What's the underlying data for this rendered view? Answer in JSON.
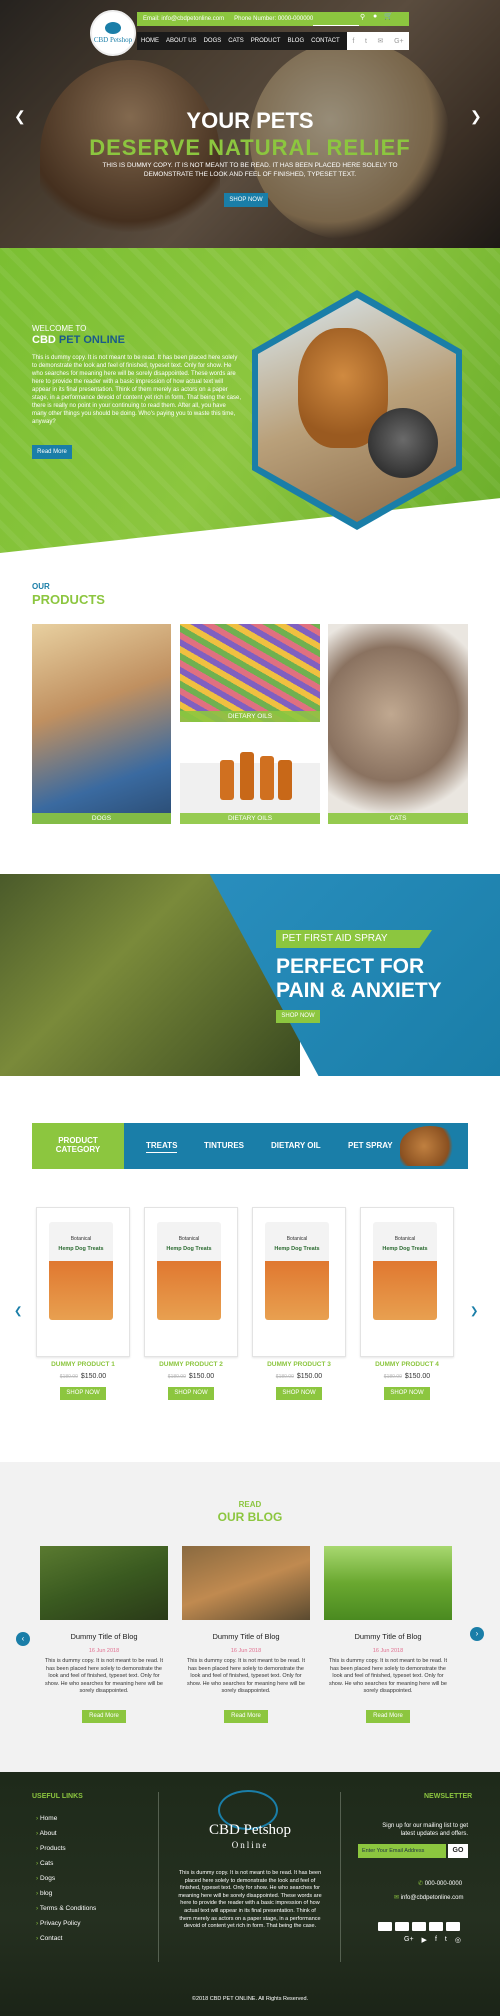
{
  "header": {
    "logo_text": "CBD Petshop",
    "topbar_email": "Email: info@cbdpetonline.com",
    "topbar_phone": "Phone Number: 0000-000000",
    "cart_count": "0",
    "nav": [
      "HOME",
      "ABOUT US",
      "DOGS",
      "CATS",
      "PRODUCT",
      "BLOG",
      "CONTACT"
    ],
    "social_icons": [
      "f",
      "t",
      "✉",
      "G+"
    ]
  },
  "hero": {
    "title1": "YOUR PETS",
    "title2": "DESERVE NATURAL RELIEF",
    "subtitle": "THIS IS DUMMY COPY. IT IS NOT MEANT TO BE READ. IT HAS BEEN PLACED HERE SOLELY TO DEMONSTRATE THE LOOK AND FEEL OF FINISHED, TYPESET TEXT.",
    "button": "SHOP NOW"
  },
  "welcome": {
    "small": "WELCOME TO",
    "title_a": "CBD",
    "title_b": "PET ONLINE",
    "text": "This is dummy copy. It is not meant to be read. It has been placed here solely to demonstrate the look and feel of finished, typeset text. Only for show. He who searches for meaning here will be sorely disappointed. These words are here to provide the reader with a basic impression of how actual text will appear in its final presentation. Think of them merely as actors on a paper stage, in a performance devoid of content yet rich in form. That being the case, there is really no point in your continuing to read them. After all, you have many other things you should be doing. Who's paying you to waste this time, anyway?",
    "button": "Read More"
  },
  "products": {
    "small": "OUR",
    "title": "PRODUCTS",
    "tiles": [
      "DOGS",
      "DIETARY OILS",
      "DIETARY OILS",
      "CATS"
    ]
  },
  "promo": {
    "tag": "PET FIRST AID SPRAY",
    "line1": "PERFECT FOR",
    "line2": "PAIN & ANXIETY",
    "button": "SHOP NOW"
  },
  "category": {
    "label_line1": "PRODUCT",
    "label_line2": "CATEGORY",
    "tabs": [
      "TREATS",
      "TINTURES",
      "DIETARY OIL",
      "PET SPRAY"
    ]
  },
  "product_cards": [
    {
      "brand": "Botanical",
      "name": "Hemp Dog Treats",
      "title": "DUMMY PRODUCT 1",
      "old": "$180.00",
      "price": "$150.00",
      "button": "SHOP NOW"
    },
    {
      "brand": "Botanical",
      "name": "Hemp Dog Treats",
      "title": "DUMMY PRODUCT 2",
      "old": "$180.00",
      "price": "$150.00",
      "button": "SHOP NOW"
    },
    {
      "brand": "Botanical",
      "name": "Hemp Dog Treats",
      "title": "DUMMY PRODUCT 3",
      "old": "$180.00",
      "price": "$150.00",
      "button": "SHOP NOW"
    },
    {
      "brand": "Botanical",
      "name": "Hemp Dog Treats",
      "title": "DUMMY PRODUCT 4",
      "old": "$180.00",
      "price": "$150.00",
      "button": "SHOP NOW"
    }
  ],
  "blog": {
    "small": "READ",
    "title": "OUR BLOG",
    "posts": [
      {
        "title": "Dummy Title of Blog",
        "date": "16 Jun 2018",
        "text": "This is dummy copy. It is not meant to be read. It has been placed here solely to demonstrate the look and feel of finished, typeset text. Only for show. He who searches for meaning here will be sorely disappointed.",
        "button": "Read More"
      },
      {
        "title": "Dummy Title of Blog",
        "date": "16 Jun 2018",
        "text": "This is dummy copy. It is not meant to be read. It has been placed here solely to demonstrate the look and feel of finished, typeset text. Only for show. He who searches for meaning here will be sorely disappointed.",
        "button": "Read More"
      },
      {
        "title": "Dummy Title of Blog",
        "date": "16 Jun 2018",
        "text": "This is dummy copy. It is not meant to be read. It has been placed here solely to demonstrate the look and feel of finished, typeset text. Only for show. He who searches for meaning here will be sorely disappointed.",
        "button": "Read More"
      }
    ]
  },
  "footer": {
    "useful_links_title": "USEFUL LINKS",
    "links": [
      "Home",
      "About",
      "Products",
      "Cats",
      "Dogs",
      "blog",
      "Terms & Conditions",
      "Privacy Policy",
      "Contact"
    ],
    "logo_line1": "CBD Petshop",
    "logo_line2": "Online",
    "about_text": "This is dummy copy. It is not meant to be read. It has been placed here solely to demonstrate the look and feel of finished, typeset text. Only for show. He who searches for meaning here will be sorely disappointed. These words are here to provide the reader with a basic impression of how actual text will appear in its final presentation. Think of them merely as actors on a paper stage, in a performance devoid of content yet rich in form. That being the case.",
    "newsletter_title": "NEWSLETTER",
    "newsletter_text": "Sign up for our mailing list to get latest updates and offers.",
    "email_placeholder": "Enter Your Email Address",
    "go": "GO",
    "phone": "000-000-0000",
    "email": "info@cbdpetonline.com",
    "social_icons": [
      "G+",
      "▶",
      "f",
      "t",
      "◎"
    ],
    "copyright_brand": "CBD PET ONLINE",
    "copyright": "©2018 CBD PET ONLINE. All Rights Reserved."
  }
}
